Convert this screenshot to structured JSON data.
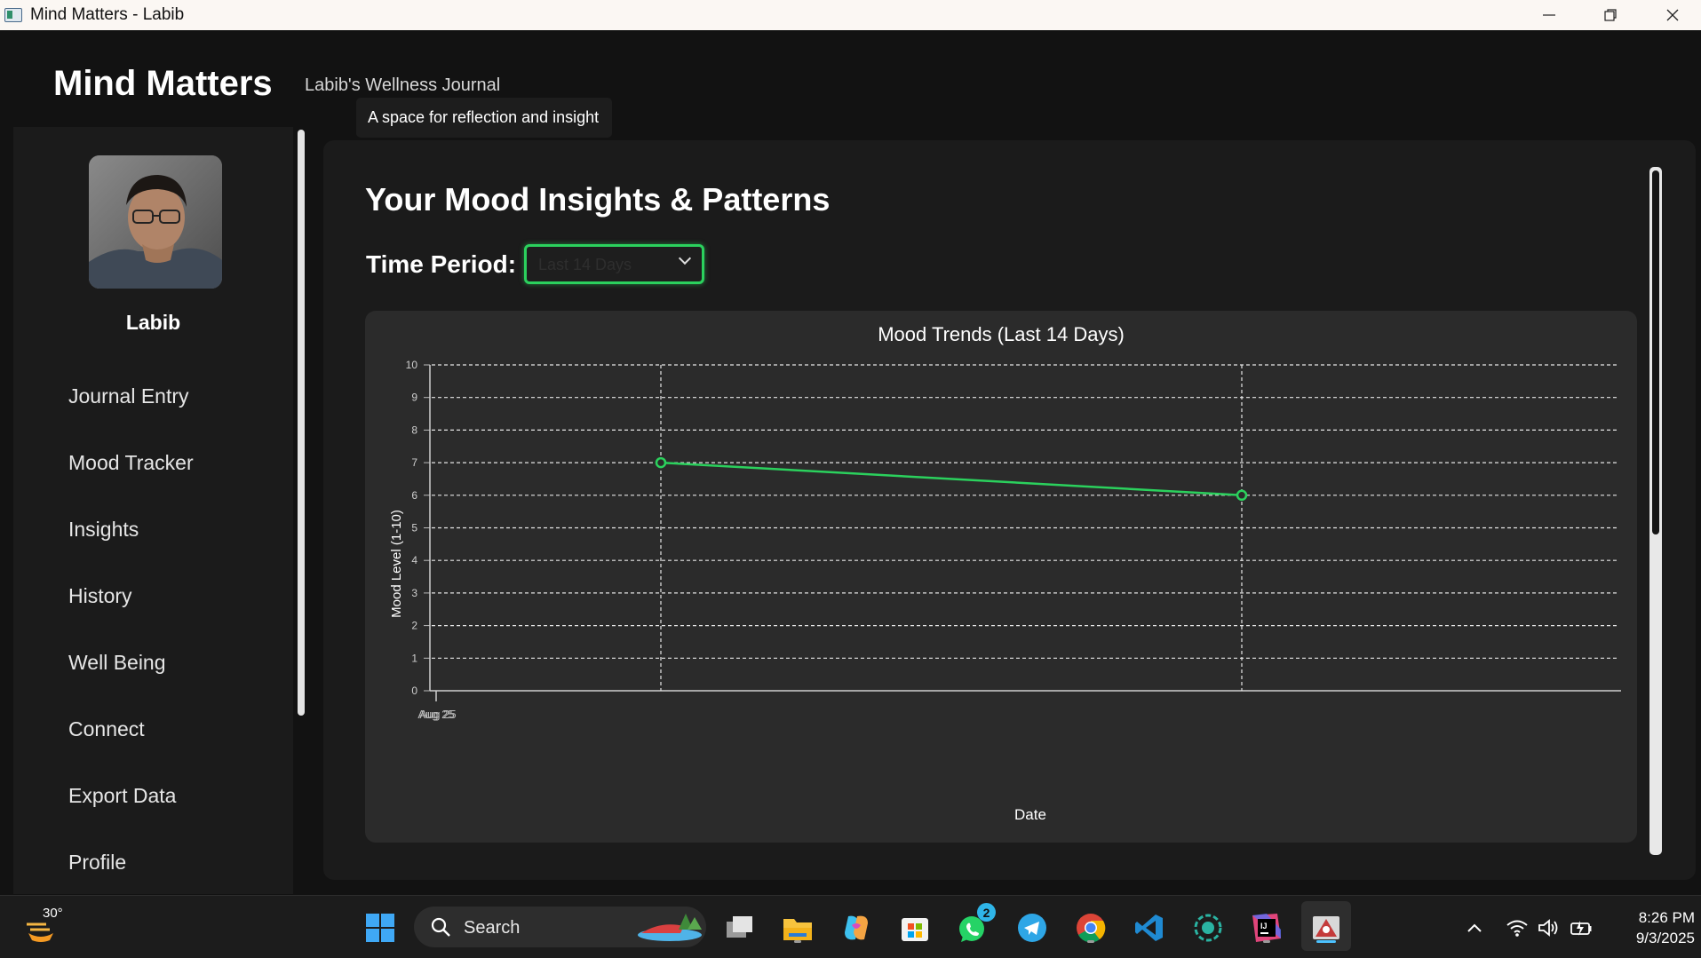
{
  "window": {
    "title": "Mind Matters - Labib",
    "controls": [
      "minimize-icon",
      "restore-icon",
      "close-icon"
    ]
  },
  "header": {
    "app_title": "Mind Matters",
    "subtitle": "Labib's Wellness Journal",
    "tooltip": "A space for reflection and insight"
  },
  "sidebar": {
    "user_name": "Labib",
    "items": [
      {
        "label": "Journal Entry"
      },
      {
        "label": "Mood Tracker"
      },
      {
        "label": "Insights"
      },
      {
        "label": "History"
      },
      {
        "label": "Well Being"
      },
      {
        "label": "Connect"
      },
      {
        "label": "Export Data"
      },
      {
        "label": "Profile"
      }
    ]
  },
  "main": {
    "title": "Your Mood Insights & Patterns",
    "period_label": "Time Period:",
    "period_value": "Last 14 Days",
    "accent_color": "#2bd15d"
  },
  "chart_data": {
    "type": "line",
    "title": "Mood Trends (Last 14 Days)",
    "xlabel": "Date",
    "ylabel": "Mood Level (1-10)",
    "ylim": [
      0,
      10
    ],
    "yticks": [
      0,
      1,
      2,
      3,
      4,
      5,
      6,
      7,
      8,
      9,
      10
    ],
    "x_tick_labels": [
      "Aug 25"
    ],
    "grid": true,
    "series": [
      {
        "values": [
          7,
          6
        ],
        "color": "#2bd15d"
      }
    ]
  },
  "taskbar": {
    "weather_temp": "30°",
    "search_label": "Search",
    "whatsapp_badge": "2",
    "time": "8:26 PM",
    "date": "9/3/2025",
    "apps": [
      "windows-start-icon",
      "task-view-icon",
      "file-explorer-icon",
      "copilot-icon",
      "microsoft-store-icon",
      "whatsapp-icon",
      "telegram-icon",
      "chrome-icon",
      "vscode-icon",
      "screen-recorder-icon",
      "intellij-icon",
      "java-app-icon"
    ],
    "tray": [
      "chevron-up-icon",
      "wifi-icon",
      "volume-icon",
      "battery-icon"
    ]
  }
}
